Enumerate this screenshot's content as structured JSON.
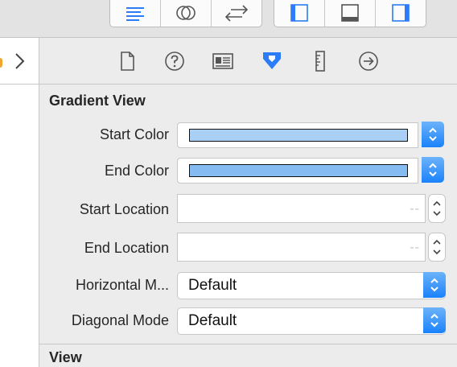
{
  "toolbar": {
    "left_group": [
      "align-left-icon",
      "overlap-circles-icon",
      "swap-arrows-icon"
    ],
    "right_group": [
      "panel-left-icon",
      "panel-bottom-icon",
      "panel-right-icon"
    ]
  },
  "inspector_tabs": [
    "file-icon",
    "help-icon",
    "identity-icon",
    "attributes-icon",
    "size-icon",
    "connections-icon"
  ],
  "gradient_view": {
    "title": "Gradient View",
    "start_color": {
      "label": "Start Color",
      "swatch": "#a9cff5"
    },
    "end_color": {
      "label": "End Color",
      "swatch": "#84bbf0"
    },
    "start_location": {
      "label": "Start Location",
      "placeholder": "--"
    },
    "end_location": {
      "label": "End Location",
      "placeholder": "--"
    },
    "horizontal_mode": {
      "label": "Horizontal M...",
      "value": "Default"
    },
    "diagonal_mode": {
      "label": "Diagonal Mode",
      "value": "Default"
    }
  },
  "view_section": {
    "title": "View"
  },
  "colors": {
    "accent": "#1a82fb",
    "active_tab": "#2b7cf6"
  }
}
